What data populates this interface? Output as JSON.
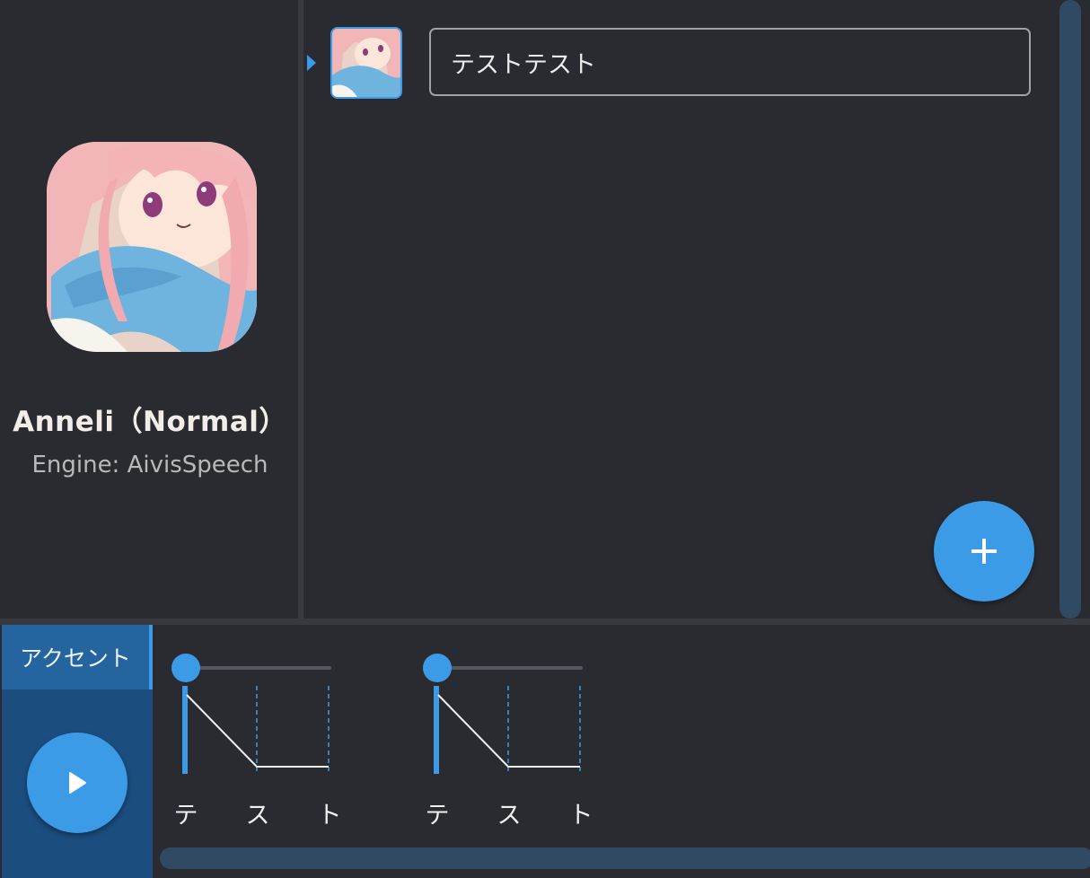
{
  "character": {
    "name": "Anneli（Normal）",
    "engine": "Engine:  AivisSpeech"
  },
  "editor": {
    "rows": [
      {
        "text": "テストテスト",
        "selected": true
      }
    ],
    "add_button_icon": "plus-icon"
  },
  "bottom": {
    "tab_label": "アクセント",
    "play_icon": "play-icon",
    "phrases": [
      {
        "morae": [
          "テ",
          "ス",
          "ト"
        ],
        "accent": 1
      },
      {
        "morae": [
          "テ",
          "ス",
          "ト"
        ],
        "accent": 1
      }
    ]
  },
  "colors": {
    "accent": "#3c9be6",
    "background": "#292b30",
    "tab_panel": "#1b4d7e",
    "scrollbar": "#2f4a62"
  }
}
